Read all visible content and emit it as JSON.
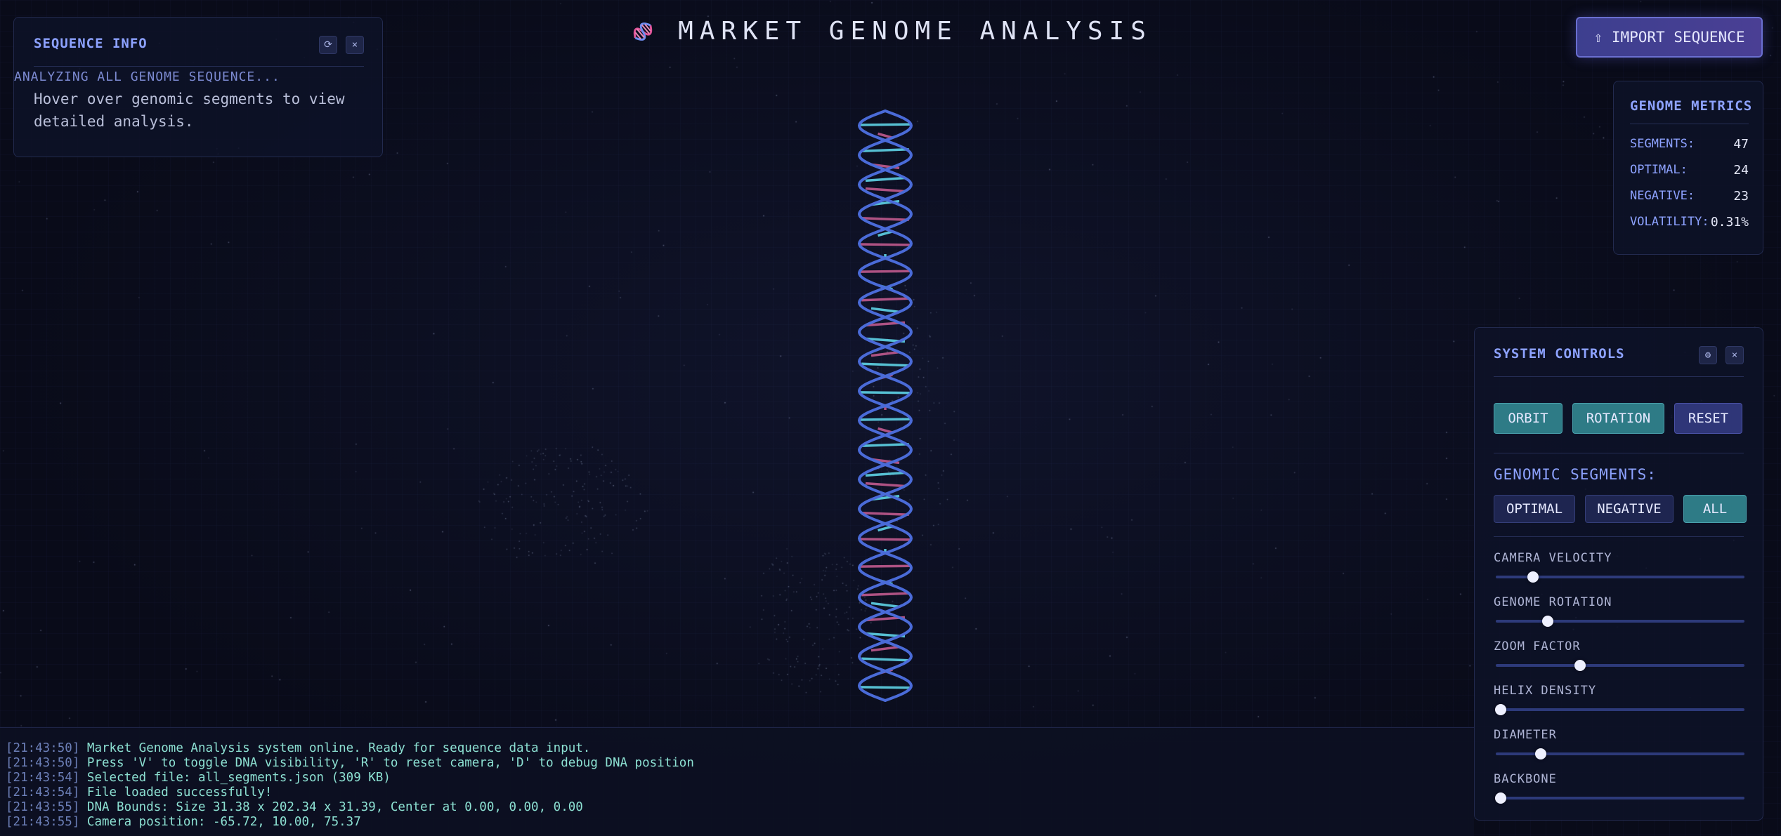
{
  "header": {
    "title": "MARKET GENOME ANALYSIS",
    "icon": "dna-icon",
    "import_label": "⇧ IMPORT SEQUENCE"
  },
  "sequence_info": {
    "title": "SEQUENCE INFO",
    "refresh_icon": "⟳",
    "close_icon": "×",
    "status": "ANALYZING ALL GENOME SEQUENCE...",
    "hint": "Hover over genomic segments to view detailed analysis."
  },
  "metrics": {
    "title": "GENOME METRICS",
    "rows": [
      {
        "label": "SEGMENTS:",
        "value": "47"
      },
      {
        "label": "OPTIMAL:",
        "value": "24"
      },
      {
        "label": "NEGATIVE:",
        "value": "23"
      },
      {
        "label": "VOLATILITY:",
        "value": "0.31%"
      }
    ]
  },
  "controls": {
    "title": "SYSTEM CONTROLS",
    "settings_icon": "⚙",
    "close_icon": "×",
    "buttons": [
      "ORBIT",
      "ROTATION",
      "RESET"
    ],
    "segments_label": "GENOMIC SEGMENTS:",
    "segment_buttons": [
      "OPTIMAL",
      "NEGATIVE",
      "ALL"
    ],
    "selected_segment": "ALL",
    "sliders": [
      {
        "label": "CAMERA VELOCITY",
        "value": 0.15
      },
      {
        "label": "GENOME ROTATION",
        "value": 0.21
      },
      {
        "label": "ZOOM FACTOR",
        "value": 0.34
      },
      {
        "label": "HELIX DENSITY",
        "value": 0.02
      },
      {
        "label": "DIAMETER",
        "value": 0.18
      },
      {
        "label": "BACKBONE",
        "value": 0.02
      }
    ]
  },
  "log": [
    {
      "time": "[21:43:50]",
      "text": "Market Genome Analysis system online. Ready for sequence data input."
    },
    {
      "time": "[21:43:50]",
      "text": "Press 'V' to toggle DNA visibility, 'R' to reset camera, 'D' to debug DNA position"
    },
    {
      "time": "[21:43:54]",
      "text": "Selected file: all_segments.json (309 KB)"
    },
    {
      "time": "[21:43:54]",
      "text": "File loaded successfully!"
    },
    {
      "time": "[21:43:55]",
      "text": "DNA Bounds: Size 31.38 x 202.34 x 31.39, Center at 0.00, 0.00, 0.00"
    },
    {
      "time": "[21:43:55]",
      "text": "Camera position: -65.72, 10.00, 75.37"
    }
  ],
  "colors": {
    "background": "#090b19",
    "accent": "#8da2ff",
    "teal": "#2e7b86",
    "helix_blue": "#4a6bd8",
    "rung_cyan": "#5fd3e6",
    "rung_pink": "#c05a8e"
  }
}
